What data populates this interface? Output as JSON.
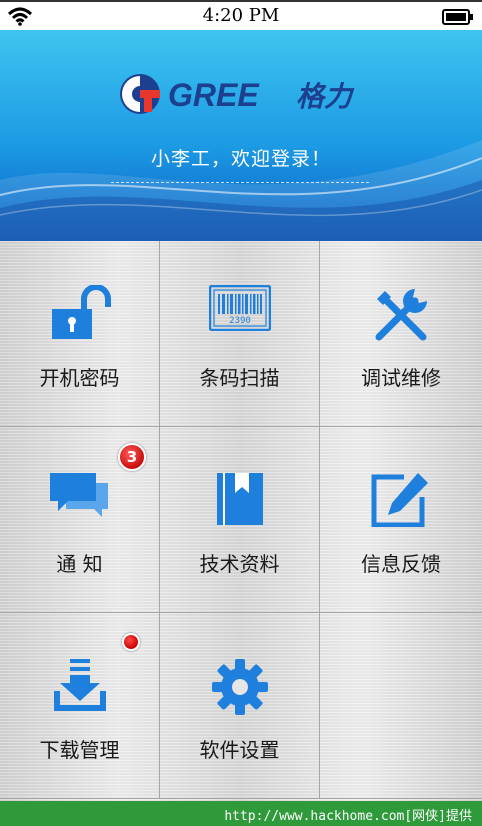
{
  "status_bar": {
    "time": "4:20 PM",
    "wifi_icon": "wifi-icon",
    "battery_icon": "battery-icon"
  },
  "header": {
    "logo_text": "GREE",
    "logo_cn": "格力",
    "welcome": "小李工，欢迎登录！",
    "gradient_top": "#3fc4f0",
    "gradient_bottom": "#0a5cc2"
  },
  "menu": {
    "accent": "#1e7fdc",
    "items": [
      {
        "label": "开机密码",
        "icon": "unlock-icon"
      },
      {
        "label": "条码扫描",
        "icon": "barcode-icon",
        "barcode_digits": "2390"
      },
      {
        "label": "调试维修",
        "icon": "tools-icon"
      },
      {
        "label": "通知",
        "display_label": "通 知",
        "icon": "chat-icon",
        "badge": "3"
      },
      {
        "label": "技术资料",
        "icon": "book-icon"
      },
      {
        "label": "信息反馈",
        "icon": "edit-icon"
      },
      {
        "label": "下载管理",
        "icon": "download-icon",
        "dot": true
      },
      {
        "label": "软件设置",
        "icon": "gear-icon"
      }
    ]
  },
  "footer": {
    "text": "http://www.hackhome.com[网侠]提供",
    "color": "#2e9a3a"
  }
}
